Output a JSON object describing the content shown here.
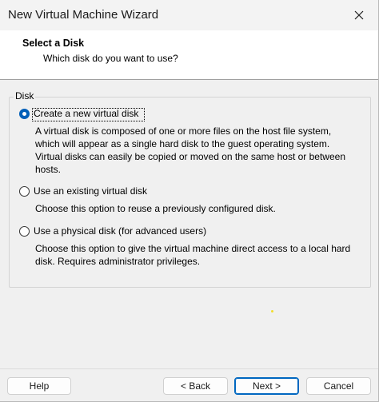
{
  "window": {
    "title": "New Virtual Machine Wizard"
  },
  "header": {
    "title": "Select a Disk",
    "subtitle": "Which disk do you want to use?"
  },
  "group": {
    "label": "Disk"
  },
  "options": [
    {
      "label": "Create a new virtual disk",
      "selected": true,
      "description_lines": [
        "A virtual disk is composed of one or more files on the host file system,",
        "which will appear as a single hard disk to the guest operating system.",
        "Virtual disks can easily be copied or moved on the same host or between",
        "hosts."
      ]
    },
    {
      "label": "Use an existing virtual disk",
      "selected": false,
      "description_lines": [
        "Choose this option to reuse a previously configured disk."
      ]
    },
    {
      "label": "Use a physical disk (for advanced users)",
      "selected": false,
      "description_lines": [
        "Choose this option to give the virtual machine direct access to a local hard",
        "disk. Requires administrator privileges."
      ]
    }
  ],
  "buttons": {
    "help": "Help",
    "back": "< Back",
    "next": "Next >",
    "cancel": "Cancel"
  },
  "icons": {
    "close": "close-icon"
  },
  "colors": {
    "accent": "#005fb8",
    "header_bg": "#ffffff",
    "window_bg": "#f0f0f0"
  }
}
